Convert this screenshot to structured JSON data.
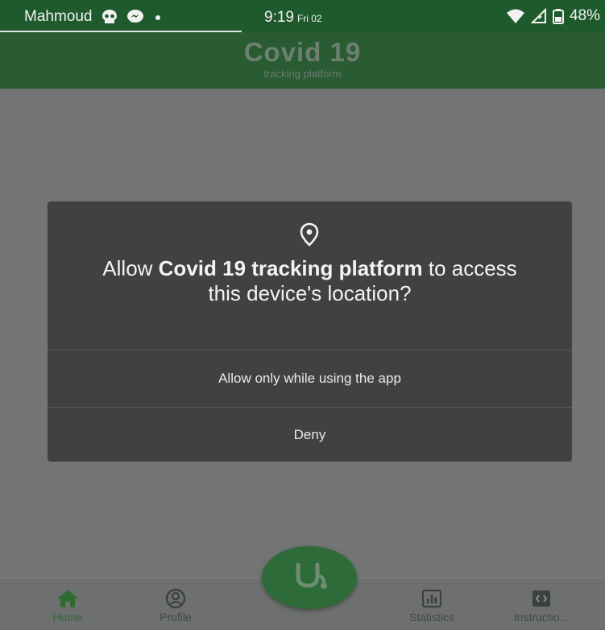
{
  "status_bar": {
    "carrier": "Mahmoud",
    "time": "9:19",
    "day": "Fri 02",
    "battery": "48%",
    "icons": [
      "skull-icon",
      "messenger-icon",
      "dot-icon",
      "wifi-icon",
      "signal-icon",
      "battery-icon"
    ]
  },
  "header": {
    "title": "Covid 19",
    "subtitle": "tracking platform"
  },
  "dialog": {
    "icon": "location-pin-icon",
    "message_prefix": "Allow ",
    "message_app": "Covid 19 tracking platform",
    "message_suffix": " to access this device's location?",
    "allow_label": "Allow only while using the app",
    "deny_label": "Deny"
  },
  "bottom_nav": {
    "items": [
      {
        "label": "Home",
        "icon": "home-icon",
        "active": true
      },
      {
        "label": "Profile",
        "icon": "profile-icon",
        "active": false
      },
      {
        "label": "Statistics",
        "icon": "statistics-icon",
        "active": false
      },
      {
        "label": "Instructio...",
        "icon": "instructions-icon",
        "active": false
      }
    ],
    "fab_icon": "stethoscope-icon"
  },
  "colors": {
    "header_green": "#2a5c33",
    "accent_green": "#2f6a33",
    "dialog_bg": "#3f4143",
    "scrim": "#727574"
  }
}
